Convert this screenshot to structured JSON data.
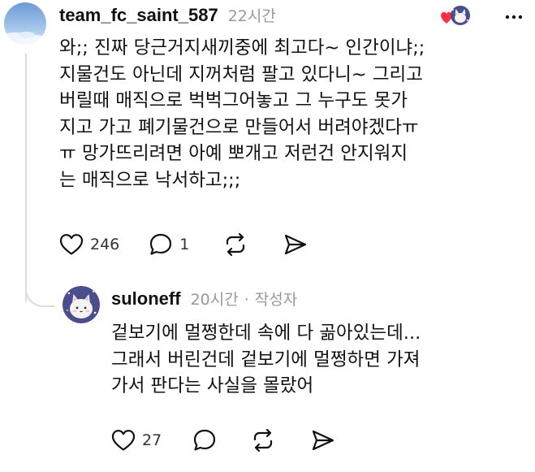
{
  "comment": {
    "username": "team_fc_saint_587",
    "timestamp": "22시간",
    "body": "와;; 진짜 당근거지새끼중에 최고다~ 인간이냐;;\n지물건도 아닌데 지꺼처럼 팔고 있다니~ 그리고\n버릴때 매직으로 벅벅그어놓고 그 누구도 못가\n지고 가고 폐기물건으로 만들어서 버려야겠다ㅠ\nㅠ 망가뜨리려면 아예 뽀개고 저런건 안지워지\n는 매직으로 낙서하고;;;",
    "like_count": "246",
    "reply_count": "1",
    "icons": {
      "like": "heart-outline-icon",
      "reply": "speech-bubble-icon",
      "repost": "repost-arrows-icon",
      "share": "paper-plane-icon",
      "liked_by_author": "heart-red-icon",
      "more": "ellipsis-icon"
    },
    "colors": {
      "liked_heart": "#ff3040",
      "avatar_sky": "#7aa7db"
    }
  },
  "reply": {
    "username": "suloneff",
    "timestamp": "20시간",
    "separator": "·",
    "author_badge": "작성자",
    "body": "겉보기에 멀쩡한데 속에 다 곪아있는데...\n그래서 버린건데 겉보기에 멀쩡하면 가져\n가서 판다는 사실을 몰랐어",
    "like_count": "27",
    "icons": {
      "like": "heart-outline-icon",
      "reply": "speech-bubble-icon",
      "repost": "repost-arrows-icon",
      "share": "paper-plane-icon"
    },
    "colors": {
      "avatar_bg": "#4a4e8a"
    }
  }
}
